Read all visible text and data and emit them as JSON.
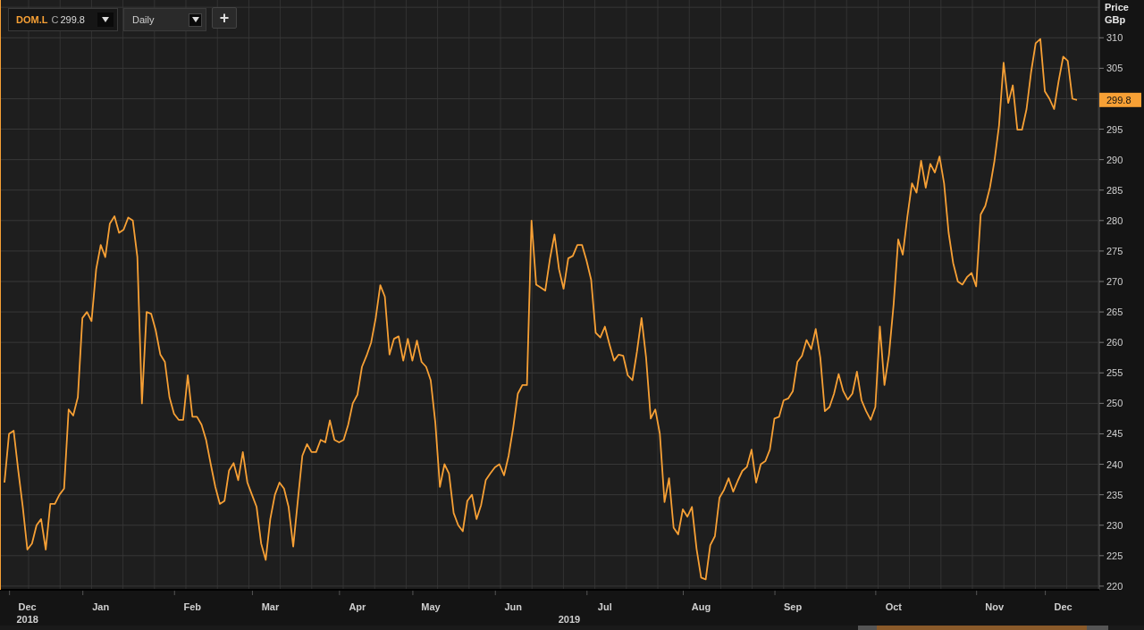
{
  "toolbar": {
    "symbol": "DOM.L",
    "price_type": "C",
    "price": "299.8",
    "interval": "Daily",
    "add_button": "+"
  },
  "chart": {
    "axis_title": "Price",
    "axis_unit": "GBp",
    "last_value_label": "299.8",
    "year_labels": [
      "2018",
      "2019"
    ],
    "chart_data": {
      "type": "line",
      "grid": true,
      "ylim": [
        219.4,
        316.2
      ],
      "categories": [
        null,
        null,
        null,
        null,
        null,
        "Dec",
        null,
        null,
        null,
        null,
        null,
        null,
        null,
        null,
        null,
        null,
        null,
        null,
        null,
        null,
        null,
        "Jan",
        null,
        null,
        null,
        null,
        null,
        null,
        null,
        null,
        null,
        null,
        null,
        null,
        null,
        null,
        null,
        null,
        null,
        null,
        null,
        "Feb",
        null,
        null,
        null,
        null,
        null,
        null,
        null,
        null,
        null,
        null,
        null,
        null,
        null,
        null,
        null,
        null,
        "Mar",
        null,
        null,
        null,
        null,
        null,
        null,
        null,
        null,
        null,
        null,
        null,
        null,
        null,
        null,
        null,
        null,
        null,
        null,
        "Apr",
        null,
        null,
        null,
        null,
        null,
        null,
        null,
        null,
        null,
        null,
        null,
        null,
        null,
        null,
        null,
        "May",
        null,
        null,
        null,
        null,
        null,
        null,
        null,
        null,
        null,
        null,
        null,
        null,
        null,
        null,
        null,
        null,
        null,
        "Jun",
        null,
        null,
        null,
        null,
        null,
        null,
        null,
        null,
        null,
        null,
        null,
        null,
        null,
        null,
        null,
        null,
        null,
        null,
        null,
        "Jul",
        null,
        null,
        null,
        null,
        null,
        null,
        null,
        null,
        null,
        null,
        null,
        null,
        null,
        null,
        null,
        null,
        null,
        null,
        null,
        null,
        "Aug",
        null,
        null,
        null,
        null,
        null,
        null,
        null,
        null,
        null,
        null,
        null,
        null,
        null,
        null,
        null,
        null,
        null,
        null,
        null,
        "Sep",
        null,
        null,
        null,
        null,
        null,
        null,
        null,
        null,
        null,
        null,
        null,
        null,
        null,
        null,
        null,
        null,
        null,
        null,
        null,
        null,
        null,
        "Oct",
        null,
        null,
        null,
        null,
        null,
        null,
        null,
        null,
        null,
        null,
        null,
        null,
        null,
        null,
        null,
        null,
        null,
        null,
        null,
        null,
        null,
        "Nov",
        null,
        null,
        null,
        null,
        null,
        null,
        null,
        null,
        null,
        null,
        null,
        null,
        null,
        null,
        "Dec",
        null,
        null,
        null
      ],
      "yticks": [
        220,
        225,
        230,
        235,
        240,
        245,
        250,
        255,
        260,
        265,
        270,
        275,
        280,
        285,
        290,
        295,
        305,
        310
      ],
      "series": [
        {
          "color": "#f7a035",
          "values": [
            237,
            245,
            245.5,
            239,
            233,
            226,
            227,
            230,
            231,
            226,
            233.5,
            233.5,
            235,
            236,
            249,
            248,
            251,
            264,
            265,
            263.5,
            272,
            276,
            274,
            279.5,
            280.7,
            278,
            278.5,
            280.5,
            280,
            274,
            250,
            265,
            264.7,
            262,
            258,
            256.8,
            251,
            248.3,
            247.3,
            247.3,
            254.6,
            247.8,
            247.8,
            246.5,
            244,
            240,
            236.3,
            233.5,
            234,
            239,
            240.2,
            237.4,
            242,
            237,
            235,
            233,
            227,
            224.3,
            231,
            235,
            237,
            236,
            233,
            226.5,
            234,
            241.4,
            243.3,
            242,
            242,
            244,
            243.6,
            247.2,
            244,
            243.6,
            244,
            246.5,
            250,
            251.4,
            256,
            257.8,
            260,
            264,
            269.4,
            267.5,
            258,
            260.6,
            261,
            257,
            260.6,
            257,
            260.3,
            256.8,
            256,
            253.8,
            246.8,
            236.3,
            240,
            238.5,
            232,
            230,
            229,
            234,
            235,
            231,
            233.3,
            237.4,
            238.5,
            239.5,
            240,
            238.2,
            241.4,
            246,
            251.6,
            253,
            253,
            280,
            269.5,
            269,
            268.5,
            273.7,
            277.7,
            272,
            268.8,
            273.8,
            274.2,
            276,
            276,
            273.4,
            270.3,
            261.6,
            260.8,
            262.6,
            259.7,
            257,
            258,
            257.8,
            254.6,
            253.8,
            258.5,
            264,
            257.5,
            247.5,
            249,
            245,
            233.8,
            237.7,
            229.6,
            228.5,
            232.6,
            231.4,
            233,
            226.1,
            221.4,
            221.1,
            226.7,
            228.2,
            234.5,
            235.8,
            237.7,
            235.5,
            237.3,
            238.9,
            239.6,
            242.4,
            237,
            240,
            240.5,
            242.4,
            247.5,
            247.8,
            250.5,
            250.8,
            252,
            256.8,
            257.8,
            260.4,
            258.9,
            262.2,
            257.5,
            248.7,
            249.4,
            251.6,
            254.8,
            252,
            250.6,
            251.6,
            255.2,
            250.5,
            248.7,
            247.3,
            249.4,
            262.6,
            253,
            258,
            266.3,
            276.9,
            274.4,
            280.7,
            286.1,
            284.6,
            289.8,
            285.4,
            289.3,
            287.9,
            290.5,
            286.1,
            278,
            273,
            270,
            269.5,
            270.7,
            271.4,
            269.2,
            281,
            282.4,
            285.4,
            289.8,
            295.6,
            305.9,
            299.3,
            302.2,
            294.9,
            294.9,
            298.3,
            304.4,
            309.1,
            309.8,
            301.2,
            300,
            298.3,
            302.9,
            306.9,
            306.2,
            300,
            299.8
          ]
        }
      ]
    }
  }
}
